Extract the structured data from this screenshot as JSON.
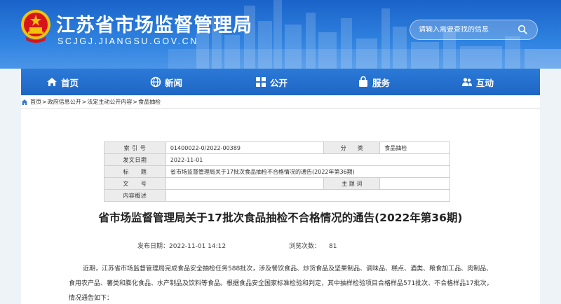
{
  "header": {
    "site_title": "江苏省市场监督管理局",
    "site_url": "SCJGJ.JIANGSU.GOV.CN",
    "search_placeholder": "请输入需要查找的信息",
    "colors": {
      "brand_blue": "#1f66c4",
      "emblem_red": "#d7141a",
      "emblem_gold": "#f4c20d"
    }
  },
  "nav": {
    "items": [
      {
        "label": "首页",
        "icon": "home-icon"
      },
      {
        "label": "新闻",
        "icon": "globe-icon"
      },
      {
        "label": "公开",
        "icon": "grid-icon"
      },
      {
        "label": "服务",
        "icon": "bag-icon"
      },
      {
        "label": "互动",
        "icon": "people-icon"
      }
    ]
  },
  "breadcrumb": {
    "items": [
      "首页",
      "政府信息公开",
      "法定主动公开内容",
      "食品抽检"
    ],
    "separator": ">"
  },
  "meta": {
    "index_label": "索 引 号",
    "index_value": "01400022-0/2022-00389",
    "category_label": "分　　类",
    "category_value": "食品抽检",
    "date_label": "发文日期",
    "date_value": "2022-11-01",
    "title_label": "标　　题",
    "title_value": "省市场监督管理局关于17批次食品抽检不合格情况的通告(2022年第36期)",
    "docno_label": "文　　号",
    "docno_value": "",
    "subject_label": "主 题 词",
    "subject_value": "",
    "summary_label": "内容概述",
    "summary_value": ""
  },
  "article": {
    "title": "省市场监督管理局关于17批次食品抽检不合格情况的通告(2022年第36期)",
    "publish_label": "发布日期：",
    "publish_value": "2022-11-01 14:12",
    "views_label": "浏览次数：",
    "views_value": "81",
    "body": "近期，江苏省市场监督管理局完成食品安全抽检任务588批次，涉及餐饮食品、炒货食品及坚果制品、调味品、糕点、酒类、粮食加工品、肉制品、食用农产品、薯类和膨化食品、水产制品及饮料等食品。根据食品安全国家标准检验和判定，其中抽样检验项目合格样品571批次、不合格样品17批次，情况通告如下："
  }
}
